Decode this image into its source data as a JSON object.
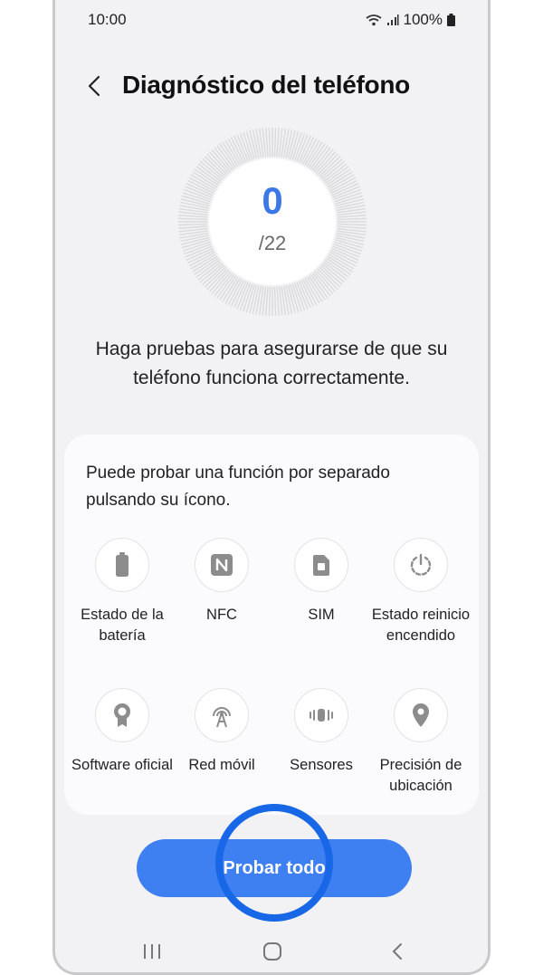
{
  "status": {
    "time": "10:00",
    "battery": "100%"
  },
  "header": {
    "title": "Diagnóstico del teléfono"
  },
  "progress": {
    "completed": "0",
    "total": "/22",
    "completed_fraction": 0
  },
  "description": "Haga pruebas para asegurarse de que su teléfono funciona correctamente.",
  "card": {
    "text": "Puede probar una función por separado pulsando su ícono.",
    "items": [
      {
        "label": "Estado de la batería",
        "icon": "battery-icon"
      },
      {
        "label": "NFC",
        "icon": "nfc-icon"
      },
      {
        "label": "SIM",
        "icon": "sim-icon"
      },
      {
        "label": "Estado reinicio encendido",
        "icon": "power-restart-icon"
      },
      {
        "label": "Software oficial",
        "icon": "award-badge-icon"
      },
      {
        "label": "Red móvil",
        "icon": "mobile-network-icon"
      },
      {
        "label": "Sensores",
        "icon": "vibration-sensor-icon"
      },
      {
        "label": "Precisión de ubicación",
        "icon": "location-pin-icon"
      }
    ]
  },
  "action": {
    "label": "Probar todo"
  },
  "colors": {
    "accent": "#3e7ff2",
    "highlight_ring": "#1767e6",
    "background": "#f2f2f4",
    "icon_gray": "#8c8c8c"
  }
}
